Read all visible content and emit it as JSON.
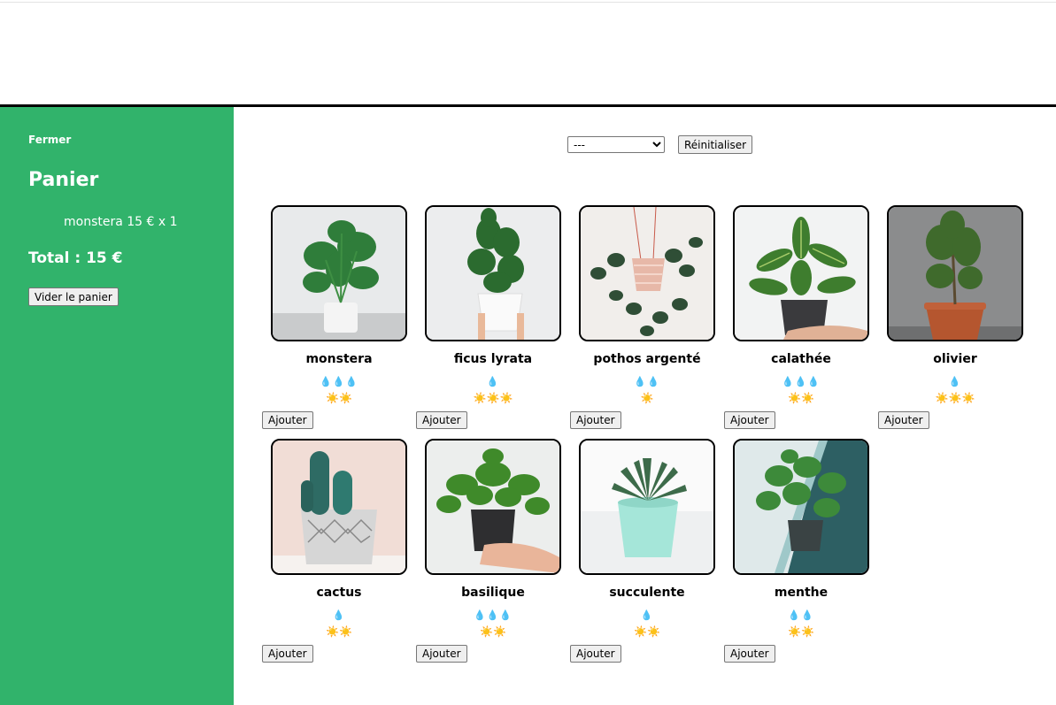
{
  "cart": {
    "close_label": "Fermer",
    "title": "Panier",
    "items": [
      {
        "text": "monstera 15 € x 1"
      }
    ],
    "total": "Total : 15 €",
    "empty_label": "Vider le panier"
  },
  "filter": {
    "selected": "---",
    "reset_label": "Réinitialiser"
  },
  "colors": {
    "sidebar": "#31b36b",
    "water": "#3d9be0",
    "sun": "#f2b705"
  },
  "plants": [
    {
      "name": "monstera",
      "water": "💧💧💧",
      "light": "☀️☀️",
      "add_label": "Ajouter",
      "image_icon": "monstera-image"
    },
    {
      "name": "ficus lyrata",
      "water": "💧",
      "light": "☀️☀️☀️",
      "add_label": "Ajouter",
      "image_icon": "ficus-image"
    },
    {
      "name": "pothos argenté",
      "water": "💧💧",
      "light": "☀️",
      "add_label": "Ajouter",
      "image_icon": "pothos-image"
    },
    {
      "name": "calathée",
      "water": "💧💧💧",
      "light": "☀️☀️",
      "add_label": "Ajouter",
      "image_icon": "calathea-image"
    },
    {
      "name": "olivier",
      "water": "💧",
      "light": "☀️☀️☀️",
      "add_label": "Ajouter",
      "image_icon": "olive-tree-image"
    },
    {
      "name": "cactus",
      "water": "💧",
      "light": "☀️☀️",
      "add_label": "Ajouter",
      "image_icon": "cactus-image"
    },
    {
      "name": "basilique",
      "water": "💧💧💧",
      "light": "☀️☀️",
      "add_label": "Ajouter",
      "image_icon": "basil-image"
    },
    {
      "name": "succulente",
      "water": "💧",
      "light": "☀️☀️",
      "add_label": "Ajouter",
      "image_icon": "succulent-image"
    },
    {
      "name": "menthe",
      "water": "💧💧",
      "light": "☀️☀️",
      "add_label": "Ajouter",
      "image_icon": "mint-image"
    }
  ]
}
